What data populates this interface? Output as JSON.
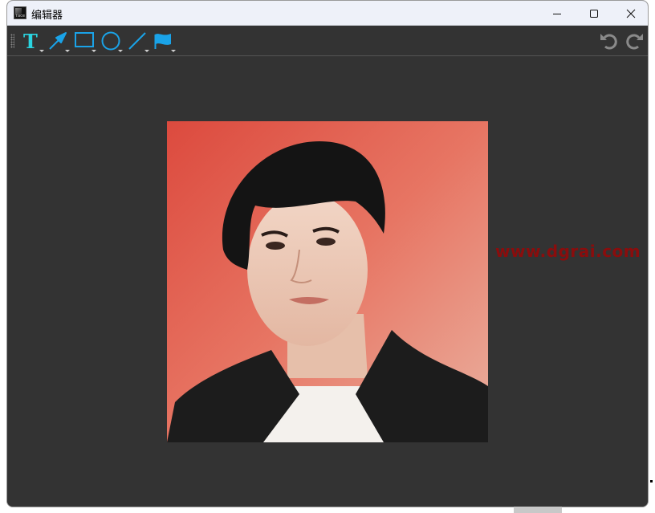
{
  "window": {
    "title": "编辑器",
    "app_icon_text": "face"
  },
  "titlebar_buttons": {
    "minimize": "minimize-icon",
    "maximize": "maximize-icon",
    "close": "close-icon"
  },
  "toolbar": {
    "tools": [
      {
        "name": "text-tool",
        "icon": "text-T-icon",
        "glyph": "T"
      },
      {
        "name": "arrow-tool",
        "icon": "arrow-icon"
      },
      {
        "name": "rectangle-tool",
        "icon": "rectangle-icon"
      },
      {
        "name": "ellipse-tool",
        "icon": "ellipse-icon"
      },
      {
        "name": "line-tool",
        "icon": "line-icon"
      },
      {
        "name": "flag-tool",
        "icon": "flag-icon"
      }
    ],
    "undo": "undo-icon",
    "redo": "redo-icon",
    "accent_color": "#1aa3e8",
    "text_tool_color": "#2ad4e0"
  },
  "canvas": {
    "image_description": "portrait-photo",
    "watermark": "www.dgrai.com"
  },
  "colors": {
    "window_bg": "#333333",
    "titlebar_bg": "#eef1f9",
    "watermark": "#8a0d0d",
    "photo_bg": "#de4b3f"
  }
}
